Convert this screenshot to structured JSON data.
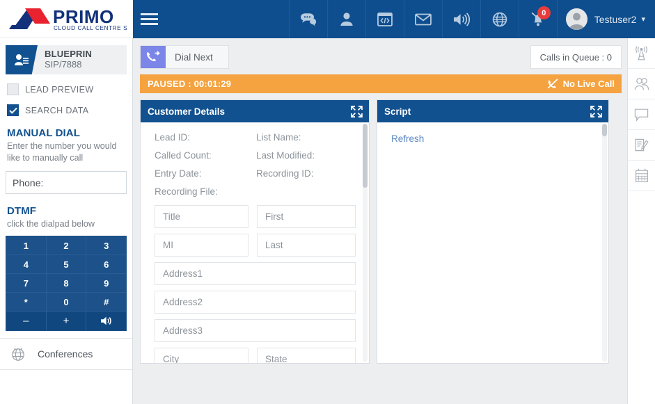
{
  "brand": {
    "name": "PRIMO",
    "tagline": "CLOUD CALL CENTRE SOLUTION",
    "navy": "#0e4e8e",
    "red": "#e8232f",
    "accent_orange": "#f4a340"
  },
  "topnav": {
    "menu_icon": "hamburger-icon",
    "icons": [
      {
        "name": "chat-icon",
        "label": "Chat"
      },
      {
        "name": "user-icon",
        "label": "User"
      },
      {
        "name": "code-window-icon",
        "label": "Code"
      },
      {
        "name": "envelope-icon",
        "label": "Mail"
      },
      {
        "name": "speaker-icon",
        "label": "Sound"
      },
      {
        "name": "globe-icon",
        "label": "Language"
      },
      {
        "name": "bell-muted-icon",
        "label": "Notifications"
      }
    ],
    "notification_count": "0",
    "username": "Testuser2",
    "caret": "⌄"
  },
  "sidebar": {
    "agent": {
      "name": "BLUEPRIN",
      "sip": "SIP/7888",
      "icon": "agent-badge-icon"
    },
    "checkboxes": [
      {
        "label": "LEAD PREVIEW",
        "checked": false,
        "name": "lead-preview"
      },
      {
        "label": "SEARCH DATA",
        "checked": true,
        "name": "search-data"
      }
    ],
    "manual_dial": {
      "title": "MANUAL DIAL",
      "subtitle": "Enter the number you would like to manually call",
      "phone_placeholder": "Phone:",
      "phone_value": "",
      "transfer_icon": "user-check-icon",
      "call_icon": "phone-icon"
    },
    "dtmf": {
      "title": "DTMF",
      "subtitle": "click the dialpad below",
      "rows": [
        [
          "1",
          "2",
          "3"
        ],
        [
          "4",
          "5",
          "6"
        ],
        [
          "7",
          "8",
          "9"
        ],
        [
          "*",
          "0",
          "#"
        ],
        [
          "–",
          "+",
          "volume-icon"
        ]
      ]
    },
    "conferences": {
      "label": "Conferences",
      "icon": "conference-globe-icon"
    }
  },
  "main": {
    "dial_next": {
      "label": "Dial Next",
      "icon": "dial-next-phone-icon"
    },
    "queue": {
      "label": "Calls in Queue : 0"
    },
    "status": {
      "left": "PAUSED : 00:01:29",
      "right": "No Live Call",
      "right_icon": "phone-slash-icon"
    },
    "customer_panel": {
      "title": "Customer Details",
      "expand_icon": "expand-icon",
      "meta": [
        "Lead ID:",
        "List Name:",
        "Called Count:",
        "Last Modified:",
        "Entry Date:",
        "Recording ID:",
        "Recording File:",
        ""
      ],
      "fields": [
        {
          "placeholder": "Title",
          "size": "sm"
        },
        {
          "placeholder": "First",
          "size": "md"
        },
        {
          "placeholder": "MI",
          "size": "sm"
        },
        {
          "placeholder": "Last",
          "size": "md"
        },
        {
          "placeholder": "Address1",
          "size": "full"
        },
        {
          "placeholder": "Address2",
          "size": "full"
        },
        {
          "placeholder": "Address3",
          "size": "full"
        },
        {
          "placeholder": "City",
          "size": "sm"
        },
        {
          "placeholder": "State",
          "size": "md"
        }
      ]
    },
    "script_panel": {
      "title": "Script",
      "expand_icon": "expand-icon",
      "refresh_label": "Refresh"
    }
  },
  "right_rail": {
    "items": [
      {
        "name": "broadcast-icon",
        "label": "Broadcast"
      },
      {
        "name": "group-users-icon",
        "label": "Groups"
      },
      {
        "name": "chat-bubble-icon",
        "label": "Chat"
      },
      {
        "name": "notes-edit-icon",
        "label": "Notes"
      },
      {
        "name": "calendar-icon",
        "label": "Calendar"
      }
    ]
  }
}
